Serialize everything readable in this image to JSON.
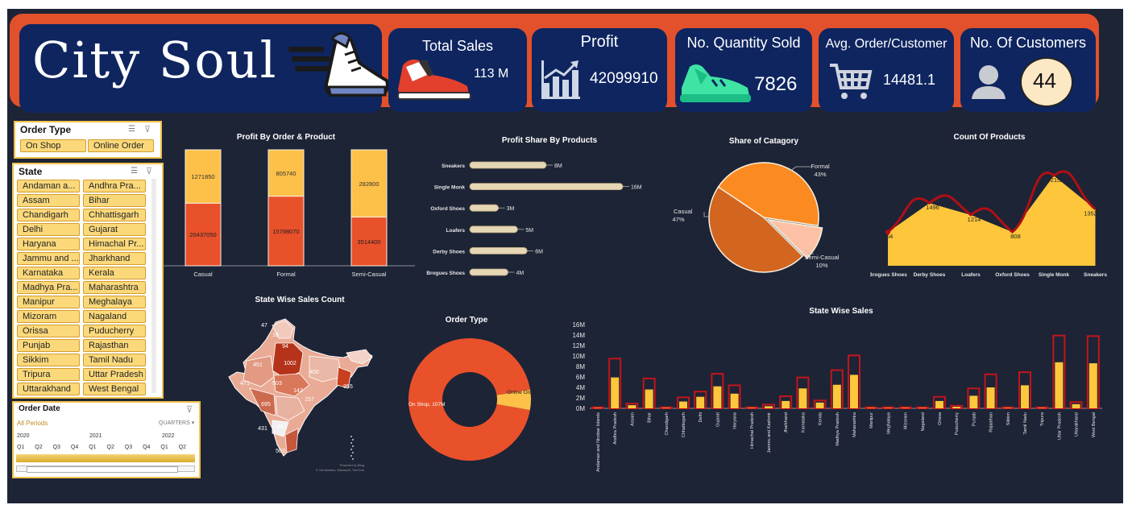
{
  "brand": {
    "name": "City Soul"
  },
  "kpis": {
    "total_sales": {
      "label": "Total Sales",
      "value": "113 M"
    },
    "profit": {
      "label": "Profit",
      "value": "42099910"
    },
    "quantity": {
      "label": "No. Quantity Sold",
      "value": "7826"
    },
    "avg_order": {
      "label": "Avg. Order/Customer",
      "value": "14481.1"
    },
    "customers": {
      "label": "No. Of Customers",
      "value": "44"
    }
  },
  "slicers": {
    "order_type": {
      "title": "Order Type",
      "options": [
        "On Shop",
        "Online Order"
      ]
    },
    "state": {
      "title": "State",
      "options": [
        "Andaman a...",
        "Andhra Pra...",
        "Assam",
        "Bihar",
        "Chandigarh",
        "Chhattisgarh",
        "Delhi",
        "Gujarat",
        "Haryana",
        "Himachal Pr...",
        "Jammu and ...",
        "Jharkhand",
        "Karnataka",
        "Kerala",
        "Madhya Pra...",
        "Maharashtra",
        "Manipur",
        "Meghalaya",
        "Mizoram",
        "Nagaland",
        "Orissa",
        "Puducherry",
        "Punjab",
        "Rajasthan",
        "Sikkim",
        "Tamil Nadu",
        "Tripura",
        "Uttar Pradesh",
        "Uttarakhand",
        "West Bengal"
      ]
    },
    "order_date": {
      "title": "Order Date",
      "period": "All Periods",
      "level": "QUARTERS",
      "years": [
        "2020",
        "2021",
        "2022"
      ],
      "quarters": [
        "Q1",
        "Q2",
        "Q3",
        "Q4",
        "Q1",
        "Q2",
        "Q3",
        "Q4",
        "Q1",
        "Q2"
      ]
    }
  },
  "colors": {
    "orange": "#e2512b",
    "navy": "#0e2560",
    "yellow": "#fdc84a",
    "bg": "#1d2436"
  },
  "map": {
    "title": "State Wise Sales Count",
    "labels": [
      "47",
      "16",
      "94",
      "1002",
      "451",
      "400",
      "471",
      "503",
      "955",
      "142",
      "695",
      "157",
      "661",
      "431",
      "503"
    ],
    "credit": "Powered by Bing\n© GeoNames, Microsoft, TomTom"
  },
  "chart_data": [
    {
      "type": "bar",
      "title": "Profit By Order & Product",
      "categories": [
        "Casual",
        "Formal",
        "Semi-Casual"
      ],
      "series": [
        {
          "values": [
            20437050,
            15788070,
            3514400
          ]
        },
        {
          "values": [
            1271850,
            805740,
            282800
          ]
        }
      ],
      "stacked": true
    },
    {
      "type": "bar",
      "title": "Profit Share By Products",
      "orientation": "horizontal",
      "categories": [
        "Sneakers",
        "Single Monk",
        "Oxford Shoes",
        "Loafers",
        "Derby Shoes",
        "Brogues Shoes"
      ],
      "values": [
        8,
        16,
        3,
        5,
        6,
        4
      ],
      "data_labels": [
        "8M",
        "16M",
        "3M",
        "5M",
        "6M",
        "4M"
      ]
    },
    {
      "type": "pie",
      "title": "Share of Catagory",
      "categories": [
        "Formal",
        "Casual",
        "Semi-Casual"
      ],
      "values": [
        43,
        47,
        10
      ],
      "data_labels": [
        "43%",
        "47%",
        "10%"
      ]
    },
    {
      "type": "area",
      "title": "Count Of Products",
      "categories": [
        "Brogues Shoes",
        "Derby Shoes",
        "Loafers",
        "Oxford Shoes",
        "Single Monk",
        "Sneakers"
      ],
      "values": [
        804,
        1496,
        1214,
        808,
        2152,
        1352
      ],
      "data_labels": [
        "804",
        "1496",
        "1214",
        "808",
        "2152",
        "1352"
      ]
    },
    {
      "type": "pie",
      "title": "Order Type",
      "categories": [
        "On Shop",
        "Online Order"
      ],
      "values": [
        107,
        6
      ],
      "data_labels": [
        "On Shop, 107M",
        "Online Order, 6M"
      ]
    },
    {
      "type": "bar",
      "title": "State Wise Sales",
      "categories": [
        "Andaman and Nicobar Islands",
        "Andhra Pradesh",
        "Assam",
        "Bihar",
        "Chandigarh",
        "Chhattisgarh",
        "Delhi",
        "Gujarat",
        "Haryana",
        "Himachal Pradesh",
        "Jammu and Kashmir",
        "Jharkhand",
        "Karnataka",
        "Kerala",
        "Madhya Pradesh",
        "Maharashtra",
        "Manipur",
        "Meghalaya",
        "Mizoram",
        "Nagaland",
        "Orissa",
        "Puducherry",
        "Punjab",
        "Rajasthan",
        "Sikkim",
        "Tamil Nadu",
        "Tripura",
        "Uttar Pradesh",
        "Uttarakhand",
        "West Bengal"
      ],
      "series": [
        {
          "values": [
            0.1,
            5.9,
            0.6,
            3.6,
            0.1,
            1.3,
            2.2,
            4.2,
            2.8,
            0.1,
            0.4,
            1.4,
            3.8,
            1.1,
            4.5,
            6.4,
            0.1,
            0.1,
            0.1,
            0.1,
            1.4,
            0.3,
            2.4,
            4.0,
            0.1,
            4.4,
            0.1,
            8.8,
            0.8,
            8.6
          ]
        },
        {
          "values": [
            0.2,
            9.5,
            0.9,
            5.7,
            0.2,
            2.1,
            3.2,
            6.6,
            4.4,
            0.2,
            0.7,
            2.3,
            5.9,
            1.5,
            7.3,
            10.1,
            0.2,
            0.2,
            0.2,
            0.2,
            2.2,
            0.5,
            3.8,
            6.5,
            0.2,
            6.9,
            0.2,
            13.9,
            1.2,
            13.8
          ]
        }
      ],
      "ylim": [
        0,
        16
      ],
      "yticks": [
        "0M",
        "2M",
        "4M",
        "6M",
        "8M",
        "10M",
        "12M",
        "14M",
        "16M"
      ]
    }
  ]
}
